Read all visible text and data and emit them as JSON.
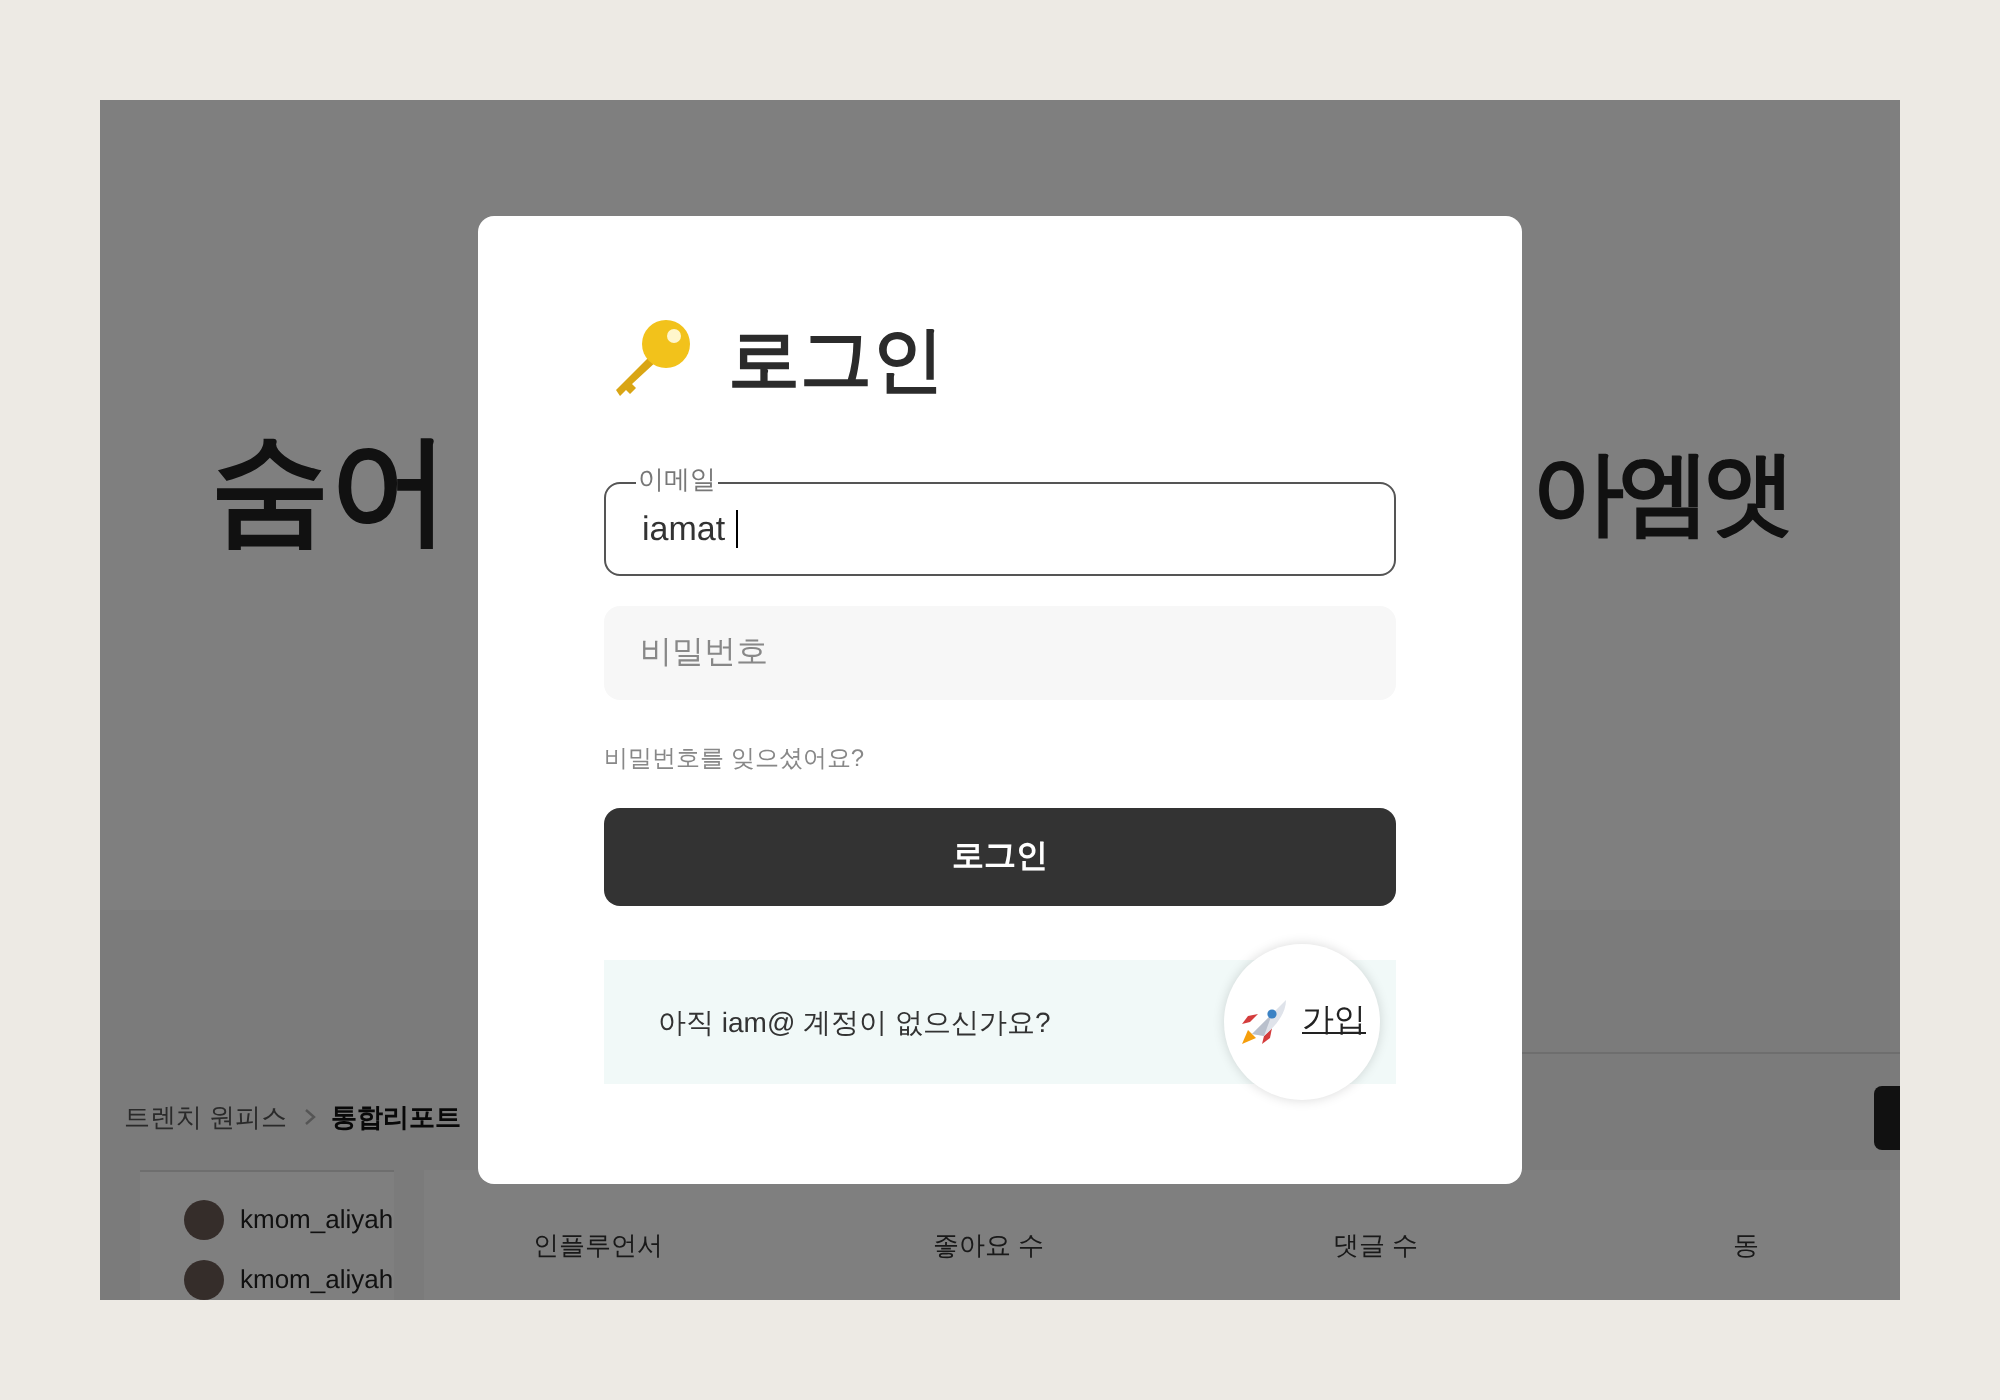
{
  "background_page": {
    "hero": {
      "headline_left": "숨어",
      "headline_right": "아엠앳"
    },
    "breadcrumb": [
      {
        "label": "트렌치 원피스",
        "current": false
      },
      {
        "label": "통합리포트",
        "current": true
      }
    ],
    "influencers": [
      {
        "name": "kmom_aliyah"
      },
      {
        "name": "kmom_aliyah"
      }
    ],
    "columns": [
      "인플루언서",
      "좋아요 수",
      "댓글 수",
      "동"
    ]
  },
  "login_dialog": {
    "title": "로그인",
    "email": {
      "label": "이메일",
      "value": "iamat",
      "focused": true
    },
    "password": {
      "placeholder": "비밀번호"
    },
    "forgot_link": "비밀번호를 잊으셨어요?",
    "submit": "로그인",
    "signup": {
      "prompt": "아직 iam@ 계정이 없으신가요?",
      "link": "가입"
    }
  }
}
